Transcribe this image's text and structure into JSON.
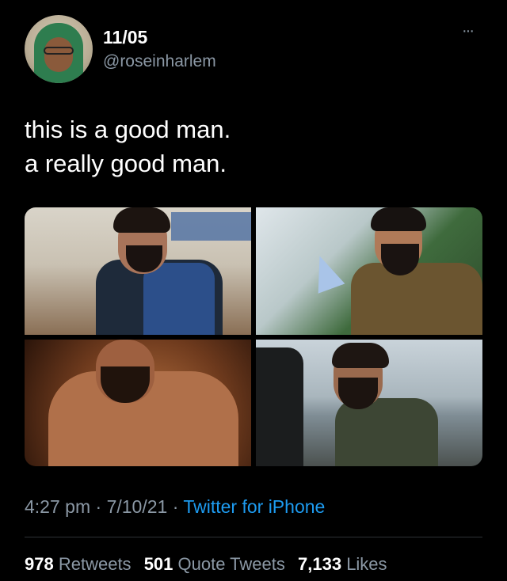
{
  "author": {
    "display_name": "11/05",
    "handle": "@roseinharlem"
  },
  "more_menu": "···",
  "tweet": {
    "lines": [
      "this is a good man.",
      "a really good man."
    ]
  },
  "media": {
    "count": 4
  },
  "meta": {
    "time": "4:27 pm",
    "sep1": " · ",
    "date": "7/10/21",
    "sep2": " · ",
    "source": "Twitter for iPhone"
  },
  "stats": {
    "retweets_count": "978",
    "retweets_label": "Retweets",
    "quotes_count": "501",
    "quotes_label": "Quote Tweets",
    "likes_count": "7,133",
    "likes_label": "Likes"
  },
  "colors": {
    "background": "#000000",
    "secondary_text": "#8b98a5",
    "link": "#1d9bf0"
  }
}
